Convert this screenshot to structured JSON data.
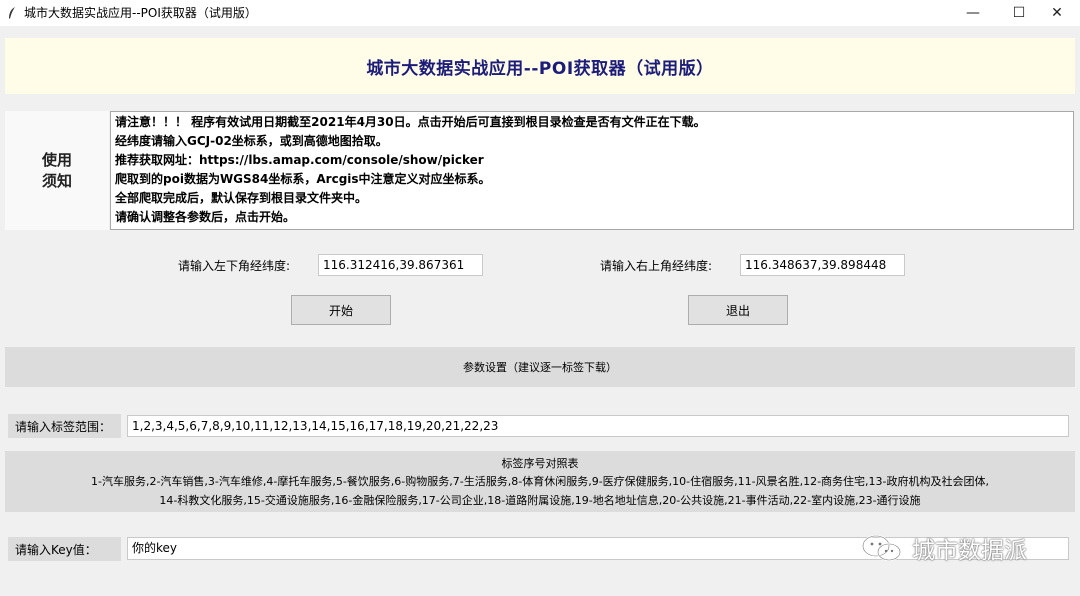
{
  "window": {
    "title": "城市大数据实战应用--POI获取器（试用版）",
    "controls": {
      "minimize": "—",
      "maximize": "☐",
      "close": "✕"
    }
  },
  "header": {
    "title": "城市大数据实战应用--POI获取器（试用版）",
    "background": "#fffde8",
    "title_color": "#1c1c7a"
  },
  "notice": {
    "label": "使用须知",
    "lines": [
      "请注意！！！ 程序有效试用日期截至2021年4月30日。点击开始后可直接到根目录检查是否有文件正在下载。",
      "经纬度请输入GCJ-02坐标系，或到高德地图拾取。",
      "推荐获取网址：https://lbs.amap.com/console/show/picker",
      "爬取到的poi数据为WGS84坐标系，Arcgis中注意定义对应坐标系。",
      "全部爬取完成后，默认保存到根目录文件夹中。",
      "请确认调整各参数后，点击开始。"
    ]
  },
  "coords": {
    "lower_left_label": "请输入左下角经纬度:",
    "lower_left_value": "116.312416,39.867361",
    "upper_right_label": "请输入右上角经纬度:",
    "upper_right_value": "116.348637,39.898448"
  },
  "buttons": {
    "start": "开始",
    "exit": "退出"
  },
  "settings": {
    "title": "参数设置（建议逐一标签下载）",
    "tag_label": "请输入标签范围：",
    "tag_value": "1,2,3,4,5,6,7,8,9,10,11,12,13,14,15,16,17,18,19,20,21,22,23",
    "legend_title": "标签序号对照表",
    "legend_line1": "1-汽车服务,2-汽车销售,3-汽车维修,4-摩托车服务,5-餐饮服务,6-购物服务,7-生活服务,8-体育休闲服务,9-医疗保健服务,10-住宿服务,11-风景名胜,12-商务住宅,13-政府机构及社会团体,",
    "legend_line2": "14-科教文化服务,15-交通设施服务,16-金融保险服务,17-公司企业,18-道路附属设施,19-地名地址信息,20-公共设施,21-事件活动,22-室内设施,23-通行设施",
    "key_label": "请输入Key值：",
    "key_value": "你的key"
  },
  "watermark": {
    "text": "城市数据派",
    "icon": "wechat-icon"
  }
}
